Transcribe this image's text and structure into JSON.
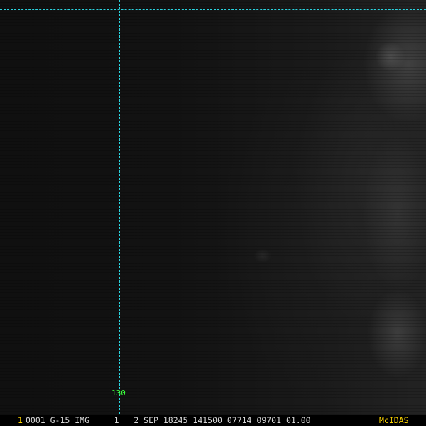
{
  "imagery": {
    "description_icon": "satellite-image"
  },
  "overlay": {
    "grid_color": "#2ad4e0",
    "label_color": "#3cff3c",
    "longitude_label": "130"
  },
  "status_bar": {
    "frame_number": "1",
    "image_info": "0001 G-15 IMG     1   2 SEP 18245 141500 07714 09701 01.00",
    "app_name": "McIDAS",
    "accent_color": "#ffd600"
  }
}
